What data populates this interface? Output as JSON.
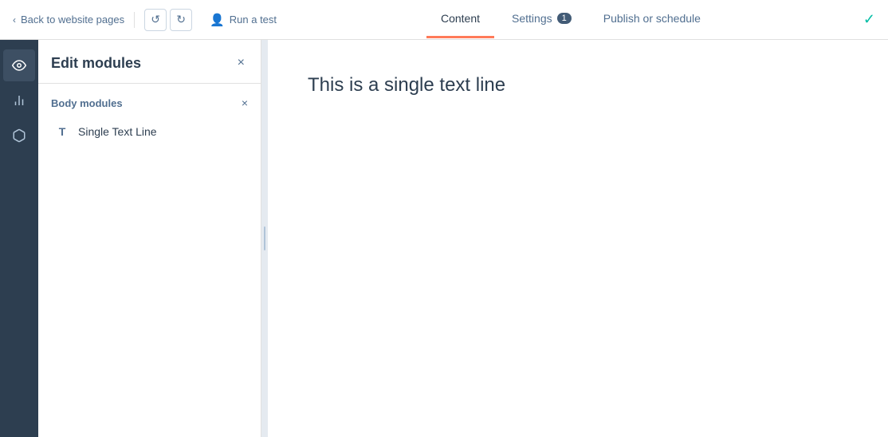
{
  "header": {
    "back_label": "Back to website pages",
    "undo_label": "↺",
    "redo_label": "↻",
    "run_test_label": "Run a test",
    "tabs": [
      {
        "id": "content",
        "label": "Content",
        "active": true,
        "badge": null
      },
      {
        "id": "settings",
        "label": "Settings",
        "active": false,
        "badge": "1"
      },
      {
        "id": "publish",
        "label": "Publish or schedule",
        "active": false,
        "badge": null
      }
    ],
    "check_icon": "✓"
  },
  "sidebar_icons": [
    {
      "id": "eye",
      "icon": "👁",
      "label": "eye-icon"
    },
    {
      "id": "chart",
      "icon": "📊",
      "label": "chart-icon"
    },
    {
      "id": "box",
      "icon": "⬡",
      "label": "box-icon"
    }
  ],
  "edit_panel": {
    "title": "Edit modules",
    "close_label": "×",
    "section_title": "Body modules",
    "section_close_label": "×",
    "modules": [
      {
        "id": "single-text-line",
        "icon": "T",
        "label": "Single Text Line"
      }
    ]
  },
  "preview": {
    "text": "This is a single text line"
  }
}
